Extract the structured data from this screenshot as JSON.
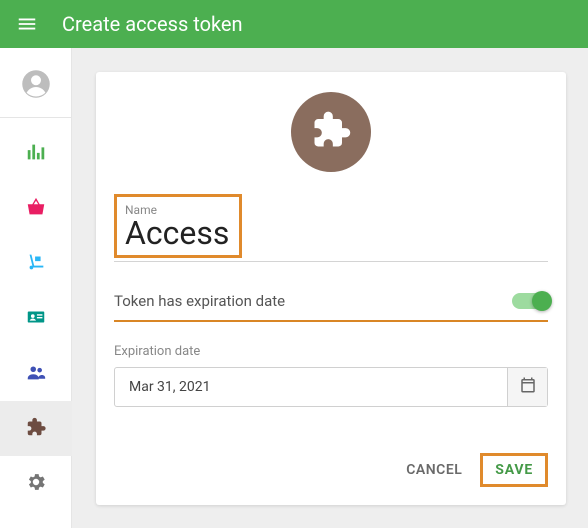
{
  "header": {
    "title": "Create access token"
  },
  "form": {
    "emblem_icon": "puzzle-piece",
    "name_label": "Name",
    "name_value": "Access",
    "toggle_label": "Token has expiration date",
    "toggle_on": true,
    "expiration_label": "Expiration date",
    "expiration_value": "Mar 31, 2021"
  },
  "actions": {
    "cancel": "CANCEL",
    "save": "SAVE"
  },
  "highlights": {
    "name_field": true,
    "save_button": true,
    "toggle_row_underline": true
  }
}
